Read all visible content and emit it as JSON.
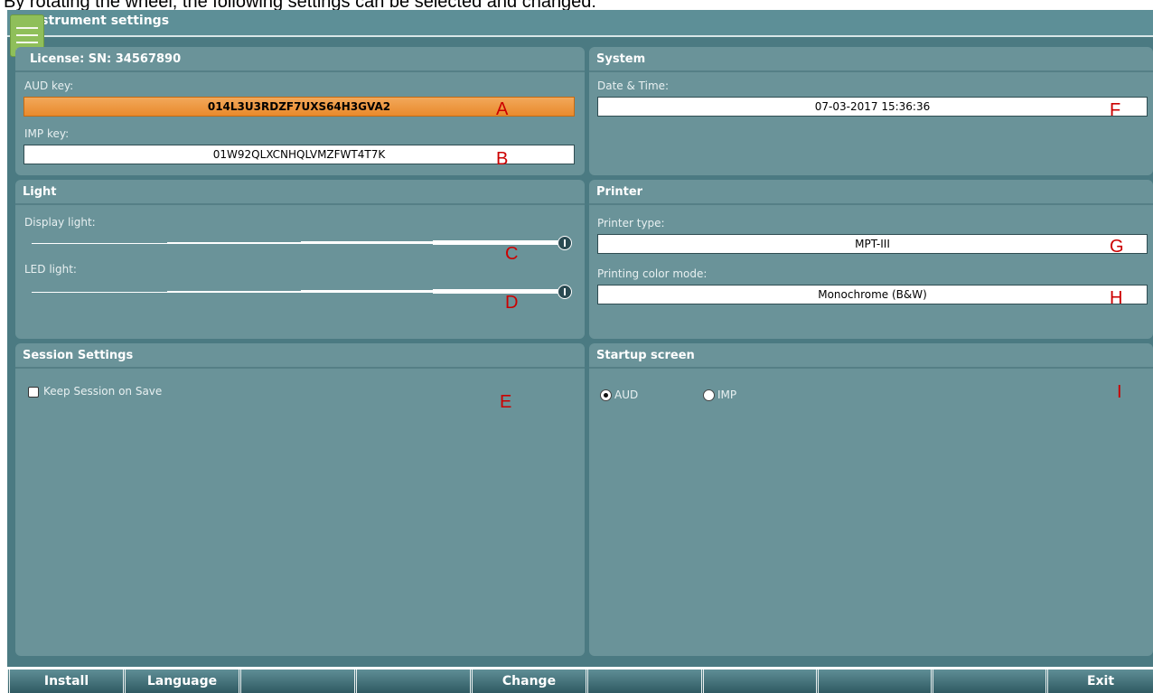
{
  "caption": "By rotating the wheel, the following settings can be selected and changed:",
  "window": {
    "title": "Instrument settings"
  },
  "license": {
    "header": "License: SN: 34567890",
    "aud_label": "AUD key:",
    "aud_value": "014L3U3RDZF7UXS64H3GVA2",
    "imp_label": "IMP key:",
    "imp_value": "01W92QLXCNHQLVMZFWT4T7K"
  },
  "system": {
    "header": "System",
    "datetime_label": "Date & Time:",
    "datetime_value": "07-03-2017 15:36:36"
  },
  "light": {
    "header": "Light",
    "display_label": "Display light:",
    "display_level": 1.0,
    "led_label": "LED light:",
    "led_level": 1.0
  },
  "printer": {
    "header": "Printer",
    "type_label": "Printer type:",
    "type_value": "MPT-III",
    "color_label": "Printing color mode:",
    "color_value": "Monochrome (B&W)"
  },
  "session": {
    "header": "Session Settings",
    "keep_label": "Keep Session on Save",
    "keep_checked": false
  },
  "startup": {
    "header": "Startup screen",
    "options": [
      "AUD",
      "IMP"
    ],
    "selected": "AUD"
  },
  "annotations": {
    "a": "A",
    "b": "B",
    "c": "C",
    "d": "D",
    "e": "E",
    "f": "F",
    "g": "G",
    "h": "H",
    "i": "I"
  },
  "function_keys": [
    "Install",
    "Language",
    "",
    "",
    "Change",
    "",
    "",
    "",
    "",
    "Exit"
  ],
  "colors": {
    "screen_bg": "#4b7a82",
    "panel_bg": "#6a9399",
    "highlight": "#e98a2c",
    "annotation": "#cc0000"
  },
  "icons": {
    "menu": "hamburger-menu-icon"
  }
}
